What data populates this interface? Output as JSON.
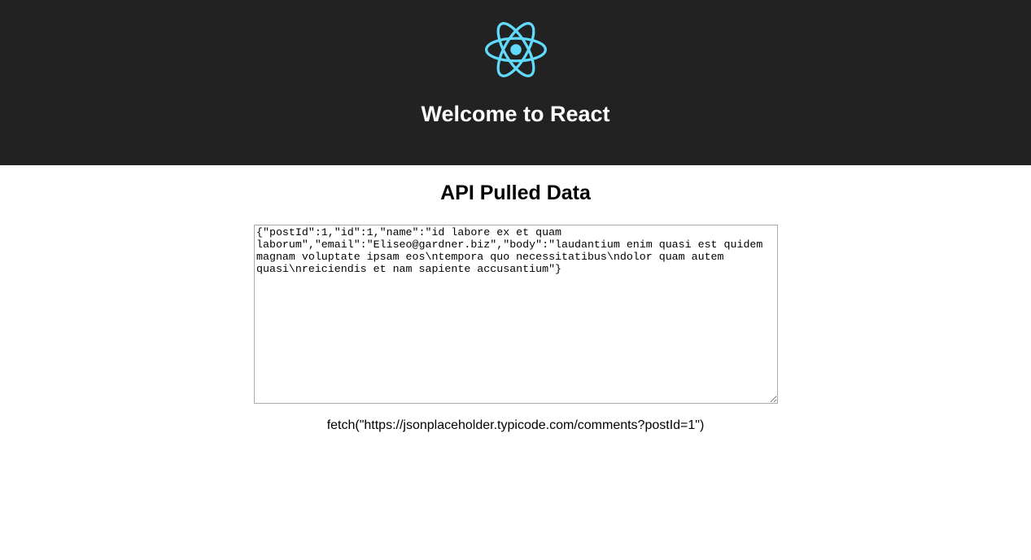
{
  "header": {
    "logo_icon": "react-logo-icon",
    "logo_color": "#61dafb",
    "title": "Welcome to React",
    "background_color": "#222222"
  },
  "main": {
    "section_title": "API Pulled Data",
    "textarea_value": "{\"postId\":1,\"id\":1,\"name\":\"id labore ex et quam laborum\",\"email\":\"Eliseo@gardner.biz\",\"body\":\"laudantium enim quasi est quidem magnam voluptate ipsam eos\\ntempora quo necessitatibus\\ndolor quam autem quasi\\nreiciendis et nam sapiente accusantium\"}",
    "fetch_caption": "fetch(\"https://jsonplaceholder.typicode.com/comments?postId=1\")"
  }
}
